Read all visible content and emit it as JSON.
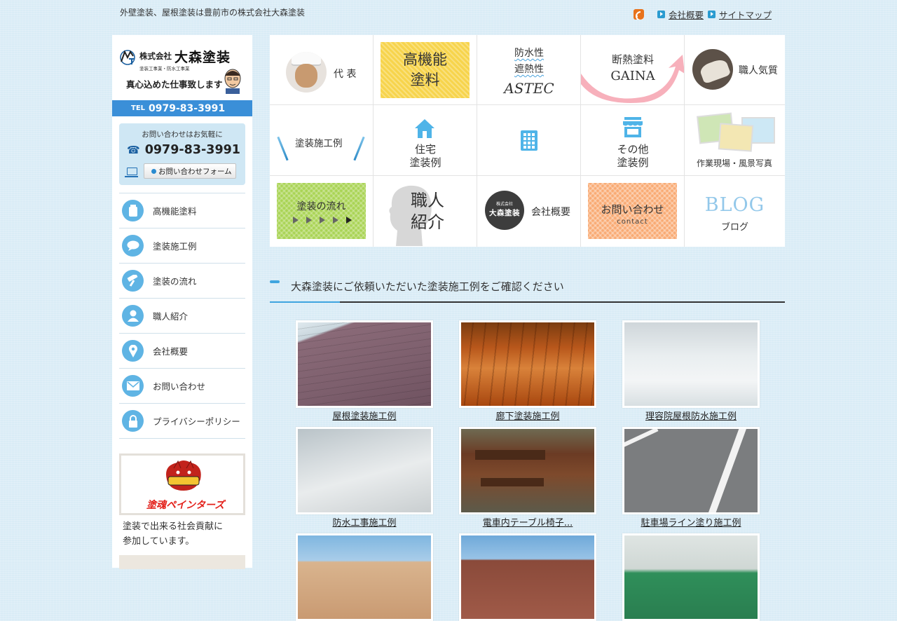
{
  "header": {
    "tagline": "外壁塗装、屋根塗装は豊前市の株式会社大森塗装",
    "links": [
      "会社概要",
      "サイトマップ"
    ]
  },
  "sidebar": {
    "logo": {
      "company_prefix": "株式会社",
      "company_name": "大森塗装",
      "sub": "塗装工事業・防水工事業",
      "slogan": "真心込めた仕事致します"
    },
    "tel_bar": {
      "prefix": "TEL",
      "number": "0979-83-3991"
    },
    "contact": {
      "title": "お問い合わせはお気軽に",
      "phone": "0979-83-3991",
      "form_button": "お問い合わせフォーム"
    },
    "nav": [
      {
        "label": "高機能塗料",
        "icon": "paint-can-icon"
      },
      {
        "label": "塗装施工例",
        "icon": "speech-bubble-icon"
      },
      {
        "label": "塗装の流れ",
        "icon": "paint-roller-icon"
      },
      {
        "label": "職人紹介",
        "icon": "person-icon"
      },
      {
        "label": "会社概要",
        "icon": "map-pin-icon"
      },
      {
        "label": "お問い合わせ",
        "icon": "mail-icon"
      },
      {
        "label": "プライバシーポリシー",
        "icon": "lock-icon"
      }
    ],
    "banner_text": "塗魂ペインターズ",
    "social_text": [
      "塗装で出来る社会貢献に",
      "参加しています。"
    ]
  },
  "grid": {
    "daihyo": "代 表",
    "koukinou": [
      "高機能",
      "塗料"
    ],
    "astec": {
      "line1": "防水性",
      "line2": "遮熱性",
      "line3": "ASTEC"
    },
    "gaina": {
      "line1": "断熱塗料",
      "line2": "GAINA"
    },
    "shokunin_kishitsu": "職人気質",
    "sekourei": "塗装施工例",
    "jutaku": [
      "住宅",
      "塗装例"
    ],
    "sonota": [
      "その他",
      "塗装例"
    ],
    "photos": "作業現場・風景写真",
    "nagare": "塗装の流れ",
    "shokunin": [
      "職人",
      "紹介"
    ],
    "kaisha": {
      "badge_small": "株式会社",
      "badge_name": "大森塗装",
      "label": "会社概要"
    },
    "contact": {
      "label": "お問い合わせ",
      "sub": "contact"
    },
    "blog": {
      "title": "BLOG",
      "sub": "ブログ"
    }
  },
  "section": {
    "heading": "大森塗装にご依頼いただいた塗装施工例をご確認ください"
  },
  "works": [
    {
      "caption": "屋根塗装施工例"
    },
    {
      "caption": "廊下塗装施工例"
    },
    {
      "caption": "理容院屋根防水施工例"
    },
    {
      "caption": "防水工事施工例"
    },
    {
      "caption": "電車内テーブル椅子..."
    },
    {
      "caption": "駐車場ライン塗り施工例"
    }
  ],
  "colors": {
    "background": "#d9ecf6",
    "accent_blue": "#3fa5df",
    "tel_bar": "#3a8fd8",
    "nav_icon": "#5fb4e4"
  }
}
